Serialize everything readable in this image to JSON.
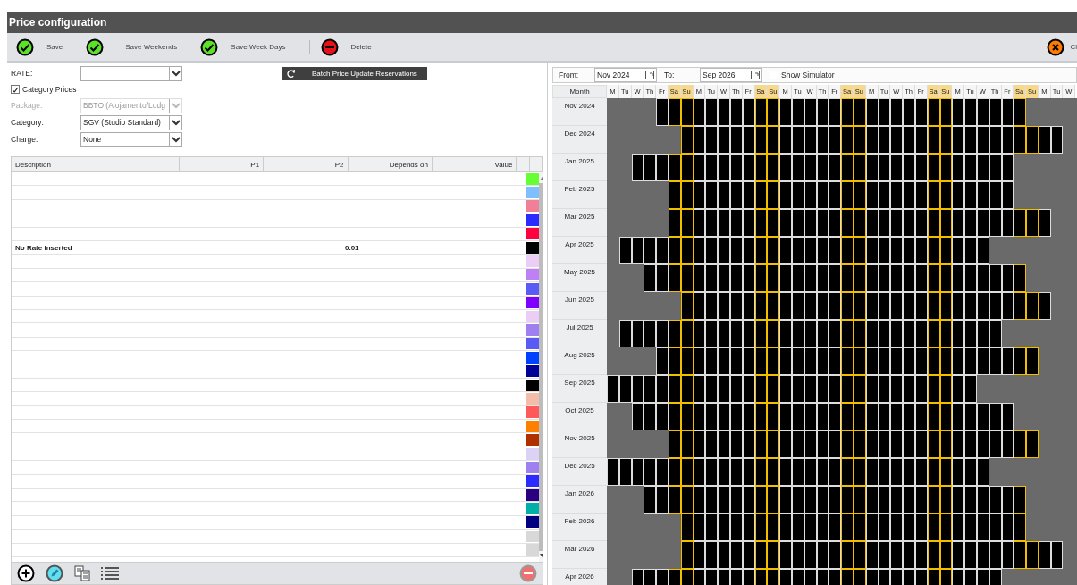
{
  "window": {
    "title": "Price configuration"
  },
  "toolbar": [
    {
      "kind": "save",
      "label": "Save"
    },
    {
      "kind": "save",
      "label": "Save Weekends"
    },
    {
      "kind": "save",
      "label": "Save Week Days"
    },
    {
      "kind": "delete",
      "label": "Delete"
    }
  ],
  "close_label": "Cl",
  "form": {
    "rate_label": "RATE:",
    "category_prices": {
      "label": "Category Prices",
      "checked": true
    },
    "fields": [
      {
        "label": "Package:",
        "value": "BBTO (Alojamento/Lodg",
        "disabled": true
      },
      {
        "label": "Category:",
        "value": "SGV (Studio Standard)",
        "disabled": false
      },
      {
        "label": "Charge:",
        "value": "None",
        "disabled": false
      }
    ],
    "batch_button": "Batch Price Update Reservations"
  },
  "table": {
    "columns": [
      "Description",
      "P1",
      "P2",
      "Depends on",
      "Value"
    ],
    "rows": [
      {
        "color": "#66ff33"
      },
      {
        "color": "#80bfff"
      },
      {
        "color": "#f08098"
      },
      {
        "color": "#2b2bff"
      },
      {
        "color": "#ff0040"
      },
      {
        "description": "No Rate Inserted",
        "p2": "0.01",
        "color": "#000000"
      },
      {
        "color": "#ebcdf5"
      },
      {
        "color": "#c080f5"
      },
      {
        "color": "#5a5af5"
      },
      {
        "color": "#8000ff"
      },
      {
        "color": "#ebcdf5"
      },
      {
        "color": "#9f80f0"
      },
      {
        "color": "#5a5af5"
      },
      {
        "color": "#0040ff"
      },
      {
        "color": "#000099"
      },
      {
        "color": "#000000"
      },
      {
        "color": "#f5bcaa"
      },
      {
        "color": "#ff5a5a"
      },
      {
        "color": "#ff8000"
      },
      {
        "color": "#b03000"
      },
      {
        "color": "#dcd2f5"
      },
      {
        "color": "#9f80f0"
      },
      {
        "color": "#2b2bff"
      },
      {
        "color": "#280080"
      },
      {
        "color": "#00b0a8"
      },
      {
        "color": "#000080"
      },
      {
        "color": "#d8d8d8"
      },
      {
        "color": "#d8d8d8"
      }
    ]
  },
  "calendar": {
    "from_label": "From:",
    "from": "Nov 2024",
    "to_label": "To:",
    "to": "Sep 2026",
    "show_simulator": {
      "label": "Show Simulator",
      "checked": false
    },
    "month_header": "Month",
    "day_headers": [
      {
        "label": "M",
        "weekend": false
      },
      {
        "label": "Tu",
        "weekend": false
      },
      {
        "label": "W",
        "weekend": false
      },
      {
        "label": "Th",
        "weekend": false
      },
      {
        "label": "Fr",
        "weekend": false
      },
      {
        "label": "Sa",
        "weekend": true
      },
      {
        "label": "Su",
        "weekend": true
      },
      {
        "label": "M",
        "weekend": false
      },
      {
        "label": "Tu",
        "weekend": false
      },
      {
        "label": "W",
        "weekend": false
      },
      {
        "label": "Th",
        "weekend": false
      },
      {
        "label": "Fr",
        "weekend": false
      },
      {
        "label": "Sa",
        "weekend": true
      },
      {
        "label": "Su",
        "weekend": true
      },
      {
        "label": "M",
        "weekend": false
      },
      {
        "label": "Tu",
        "weekend": false
      },
      {
        "label": "W",
        "weekend": false
      },
      {
        "label": "Th",
        "weekend": false
      },
      {
        "label": "Fr",
        "weekend": false
      },
      {
        "label": "Sa",
        "weekend": true
      },
      {
        "label": "Su",
        "weekend": true
      },
      {
        "label": "M",
        "weekend": false
      },
      {
        "label": "Tu",
        "weekend": false
      },
      {
        "label": "W",
        "weekend": false
      },
      {
        "label": "Th",
        "weekend": false
      },
      {
        "label": "Fr",
        "weekend": false
      },
      {
        "label": "Sa",
        "weekend": true
      },
      {
        "label": "Su",
        "weekend": true
      },
      {
        "label": "M",
        "weekend": false
      },
      {
        "label": "Tu",
        "weekend": false
      },
      {
        "label": "W",
        "weekend": false
      },
      {
        "label": "Th",
        "weekend": false
      },
      {
        "label": "Fr",
        "weekend": false
      },
      {
        "label": "Sa",
        "weekend": true
      },
      {
        "label": "Su",
        "weekend": true
      },
      {
        "label": "M",
        "weekend": false
      },
      {
        "label": "Tu",
        "weekend": false
      },
      {
        "label": "W",
        "weekend": false
      }
    ],
    "months": [
      "Nov 2024",
      "Dec 2024",
      "Jan 2025",
      "Feb 2025",
      "Mar 2025",
      "Apr 2025",
      "May 2025",
      "Jun 2025",
      "Jul 2025",
      "Aug 2025",
      "Sep 2025",
      "Oct 2025",
      "Nov 2025",
      "Dec 2025",
      "Jan 2026",
      "Feb 2026",
      "Mar 2026",
      "Apr 2026"
    ]
  }
}
